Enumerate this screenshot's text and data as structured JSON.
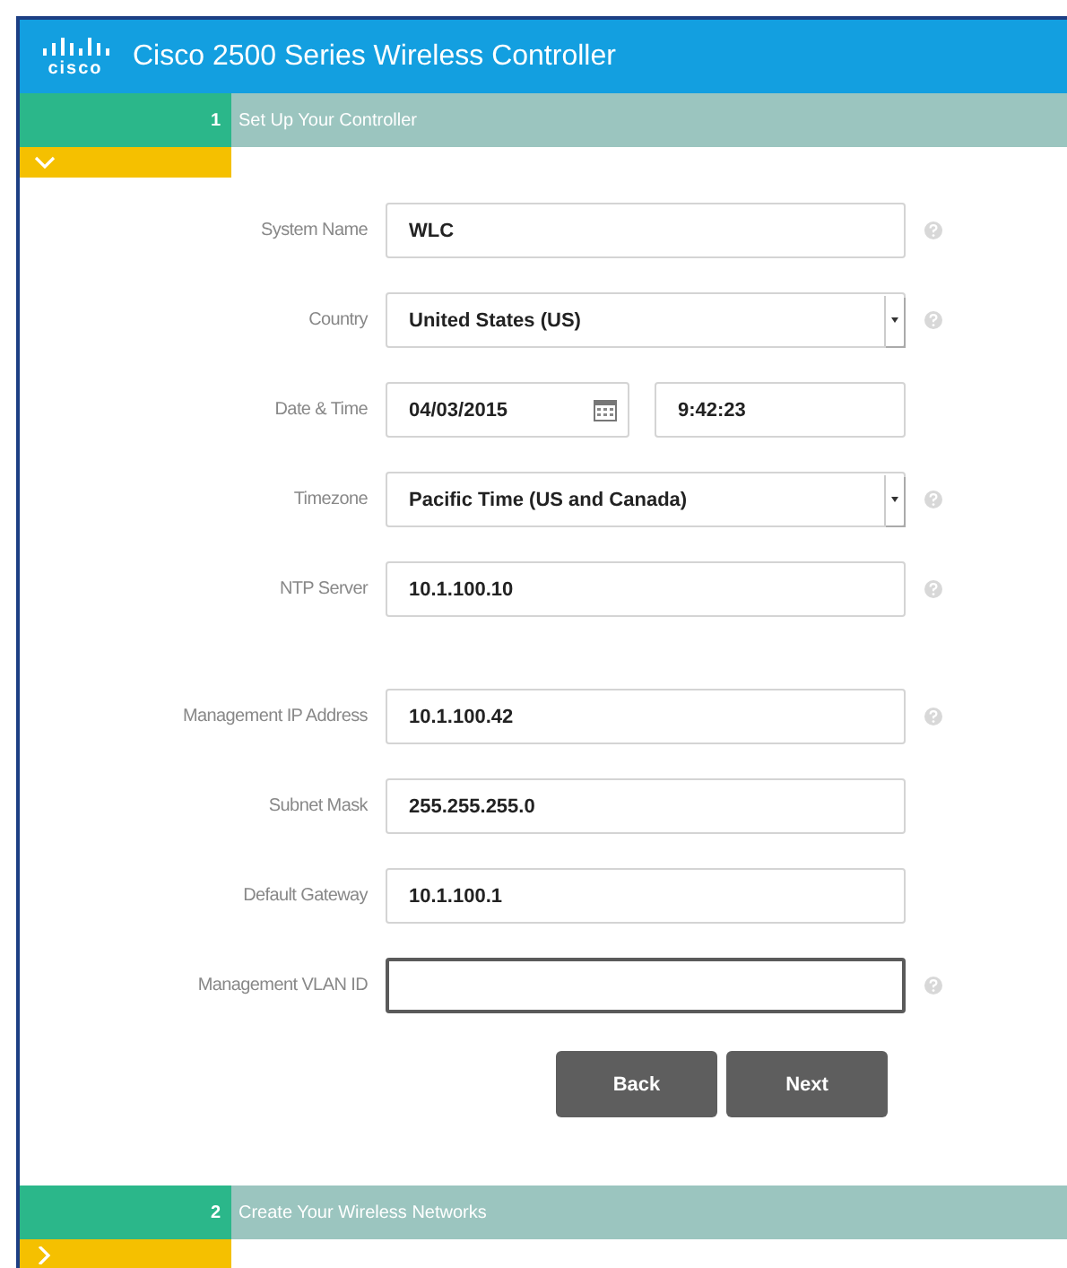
{
  "header": {
    "logo_text": "cisco",
    "title": "Cisco 2500 Series Wireless Controller"
  },
  "steps": [
    {
      "number": "1",
      "title": "Set Up Your Controller",
      "expanded": true
    },
    {
      "number": "2",
      "title": "Create Your Wireless Networks",
      "expanded": false
    }
  ],
  "form_groups": [
    [
      {
        "kind": "text",
        "label": "System Name",
        "value": "WLC",
        "help": true,
        "focused": false
      },
      {
        "kind": "select",
        "label": "Country",
        "value": "United States (US)",
        "help": true,
        "focused": false
      },
      {
        "kind": "datetime",
        "label": "Date & Time",
        "date": "04/03/2015",
        "time": "9:42:23",
        "help": false
      },
      {
        "kind": "select",
        "label": "Timezone",
        "value": "Pacific Time (US and Canada)",
        "help": true,
        "focused": false
      },
      {
        "kind": "text",
        "label": "NTP Server",
        "value": "10.1.100.10",
        "help": true,
        "focused": false
      }
    ],
    [
      {
        "kind": "text",
        "label": "Management IP Address",
        "value": "10.1.100.42",
        "help": true,
        "focused": false
      },
      {
        "kind": "text",
        "label": "Subnet Mask",
        "value": "255.255.255.0",
        "help": false,
        "focused": false
      },
      {
        "kind": "text",
        "label": "Default Gateway",
        "value": "10.1.100.1",
        "help": false,
        "focused": false
      },
      {
        "kind": "text",
        "label": "Management VLAN ID",
        "help": true,
        "focused": true
      }
    ]
  ],
  "buttons": [
    "Back",
    "Next"
  ]
}
